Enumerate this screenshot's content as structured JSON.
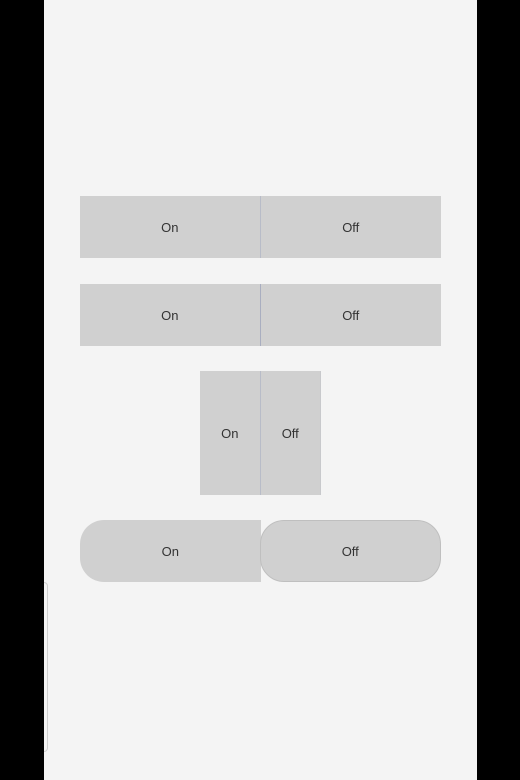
{
  "toggles": [
    {
      "on_label": "On",
      "off_label": "Off"
    },
    {
      "on_label": "On",
      "off_label": "Off"
    },
    {
      "on_label": "On",
      "off_label": "Off"
    },
    {
      "on_label": "On",
      "off_label": "Off"
    }
  ],
  "colors": {
    "background": "#f4f4f4",
    "segment": "#d0d0d0",
    "text": "#333333",
    "frame": "#000000"
  }
}
